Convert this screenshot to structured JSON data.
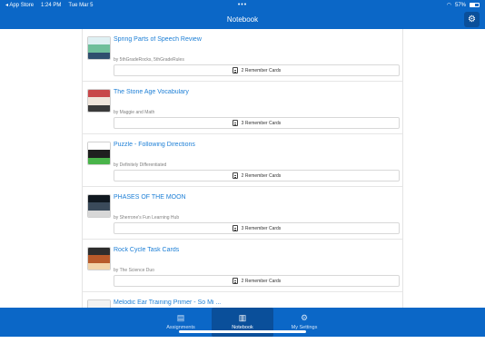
{
  "status_bar": {
    "back_app": "◂ App Store",
    "time": "1:24 PM",
    "date": "Tue Mar 5",
    "dots": "•••",
    "battery": "57%"
  },
  "header": {
    "title": "Notebook"
  },
  "items": [
    {
      "title": "Spring Parts of Speech Review",
      "author": "by 5thGradeRocks, 5thGradeRules",
      "cards": "2 Remember Cards",
      "thumb_colors": [
        "#dff0f3",
        "#6fbf9b",
        "#2f4f6e"
      ]
    },
    {
      "title": "The Stone Age Vocabulary",
      "author": "by Maggie and Math",
      "cards": "3 Remember Cards",
      "thumb_colors": [
        "#c8484a",
        "#f0e6dc",
        "#3a3a3a"
      ]
    },
    {
      "title": "Puzzle - Following Directions",
      "author": "by Definitely Differentiated",
      "cards": "2 Remember Cards",
      "thumb_colors": [
        "#ffffff",
        "#1f1f1f",
        "#49b44a"
      ]
    },
    {
      "title": "PHASES OF THE MOON",
      "author": "by Sherrone's Fun Learning Hub",
      "cards": "3 Remember Cards",
      "thumb_colors": [
        "#101820",
        "#3a4a5a",
        "#d7d7d7"
      ]
    },
    {
      "title": "Rock Cycle Task Cards",
      "author": "by The Science Duo",
      "cards": "2 Remember Cards",
      "thumb_colors": [
        "#2d2d2d",
        "#b85a2a",
        "#f2d3a8"
      ]
    },
    {
      "title": "Melodic Ear Training Primer - So Mi ...",
      "author": "",
      "cards": "",
      "thumb_colors": [
        "#f2f2f2",
        "#888888",
        "#ffffff"
      ]
    }
  ],
  "tabs": [
    {
      "label": "Assignments",
      "icon": "assignments-icon",
      "glyph": "▤"
    },
    {
      "label": "Notebook",
      "icon": "notebook-icon",
      "glyph": "▥"
    },
    {
      "label": "My Settings",
      "icon": "settings-icon",
      "glyph": "⚙"
    }
  ],
  "colors": {
    "brand": "#0b67c7",
    "active_tab": "#0a4f9a",
    "link": "#1d7fd6"
  }
}
